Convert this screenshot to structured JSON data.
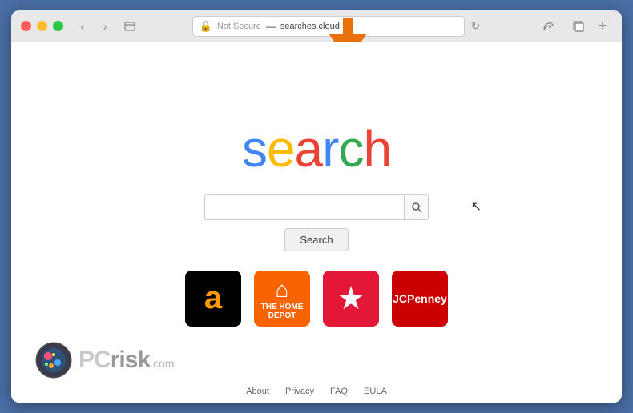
{
  "browser": {
    "address_bar": {
      "security_label": "Not Secure",
      "separator": "—",
      "url": "searches.cloud"
    },
    "nav": {
      "back_label": "‹",
      "forward_label": "›"
    }
  },
  "page": {
    "logo": {
      "text": "search",
      "letters": [
        "s",
        "e",
        "a",
        "r",
        "c",
        "h"
      ]
    },
    "search_button_label": "Search",
    "search_placeholder": ""
  },
  "bookmarks": [
    {
      "name": "Amazon",
      "id": "amazon"
    },
    {
      "name": "Home Depot",
      "id": "homedepot"
    },
    {
      "name": "Macy's",
      "id": "macys"
    },
    {
      "name": "JCPenney",
      "id": "jcpenney"
    }
  ],
  "footer": {
    "links": [
      "About",
      "Privacy",
      "FAQ",
      "EULA"
    ]
  },
  "watermark": {
    "site": "pcrisk.com"
  }
}
